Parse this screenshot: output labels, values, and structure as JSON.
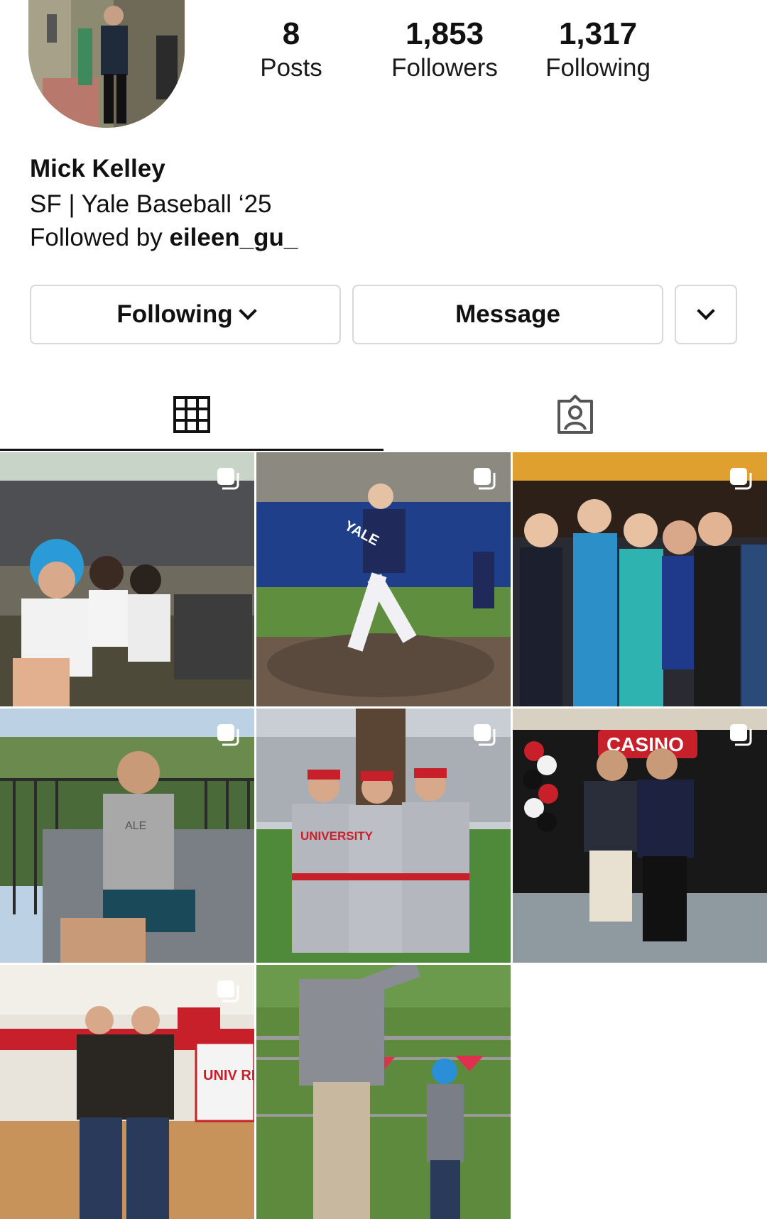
{
  "profile": {
    "name": "Mick Kelley",
    "bio": "SF | Yale Baseball ‘25",
    "followed_by_prefix": "Followed by ",
    "followed_by_user": "eileen_gu_"
  },
  "stats": {
    "posts": {
      "value": "8",
      "label": "Posts"
    },
    "followers": {
      "value": "1,853",
      "label": "Followers"
    },
    "following": {
      "value": "1,317",
      "label": "Following"
    }
  },
  "actions": {
    "following_label": "Following",
    "message_label": "Message",
    "more_icon": "chevron-down-icon"
  },
  "tabs": [
    {
      "name": "grid",
      "icon": "grid-icon",
      "active": true
    },
    {
      "name": "tagged",
      "icon": "tagged-person-icon",
      "active": false
    }
  ],
  "posts": [
    {
      "id": 1,
      "overlay_text": "",
      "multi": true
    },
    {
      "id": 2,
      "overlay_text": "YALE",
      "multi": true
    },
    {
      "id": 3,
      "overlay_text": "",
      "multi": true
    },
    {
      "id": 4,
      "overlay_text": "ALE",
      "multi": true
    },
    {
      "id": 5,
      "overlay_text": "UNIVERSITY",
      "multi": true
    },
    {
      "id": 6,
      "overlay_text": "CASINO",
      "multi": true
    },
    {
      "id": 7,
      "overlay_text": "UNIV RED",
      "multi": true
    },
    {
      "id": 8,
      "overlay_text": "",
      "multi": false
    }
  ],
  "colors": {
    "text": "#111111",
    "border": "#d8d8d8",
    "background": "#ffffff"
  }
}
